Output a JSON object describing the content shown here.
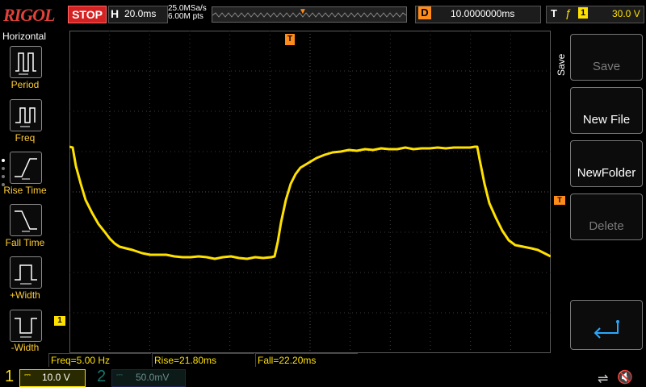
{
  "brand": "RIGOL",
  "status": {
    "run_state": "STOP"
  },
  "horizontal": {
    "letter": "H",
    "timebase": "20.0ms",
    "sample_rate": "25.0MSa/s",
    "mem_depth": "6.00M pts"
  },
  "delay": {
    "letter": "D",
    "value": "10.0000000ms"
  },
  "trigger": {
    "letter": "T",
    "source": "1",
    "level": "30.0 V",
    "edge_icon": "rising-edge-icon"
  },
  "left_menu": {
    "title": "Horizontal",
    "items": [
      {
        "label": "Period",
        "icon": "period-icon"
      },
      {
        "label": "Freq",
        "icon": "freq-icon"
      },
      {
        "label": "Rise Time",
        "icon": "rise-time-icon"
      },
      {
        "label": "Fall Time",
        "icon": "fall-time-icon"
      },
      {
        "label": "+Width",
        "icon": "pos-width-icon"
      },
      {
        "label": "-Width",
        "icon": "neg-width-icon"
      }
    ]
  },
  "markers": {
    "trigger_time": "T",
    "trigger_level": "T",
    "ch1": "1"
  },
  "measurements": [
    {
      "text": "Freq=5.00 Hz"
    },
    {
      "text": "Rise=21.80ms"
    },
    {
      "text": "Fall=22.20ms"
    }
  ],
  "channels": [
    {
      "num": "1",
      "scale": "10.0 V",
      "color": "#ffe100",
      "active": true
    },
    {
      "num": "2",
      "scale": "50.0mV",
      "color": "#1fc7b5",
      "active": false
    }
  ],
  "right_menu": {
    "title": "Save",
    "buttons": [
      {
        "label": "Save",
        "enabled": false
      },
      {
        "label": "New File",
        "enabled": true
      },
      {
        "label": "NewFolder",
        "enabled": true
      },
      {
        "label": "Delete",
        "enabled": false
      }
    ],
    "return_icon": "return-arrow-icon"
  },
  "colors": {
    "trace": "#ffe100",
    "accent": "#ff8c1a",
    "stop": "#d42222"
  }
}
